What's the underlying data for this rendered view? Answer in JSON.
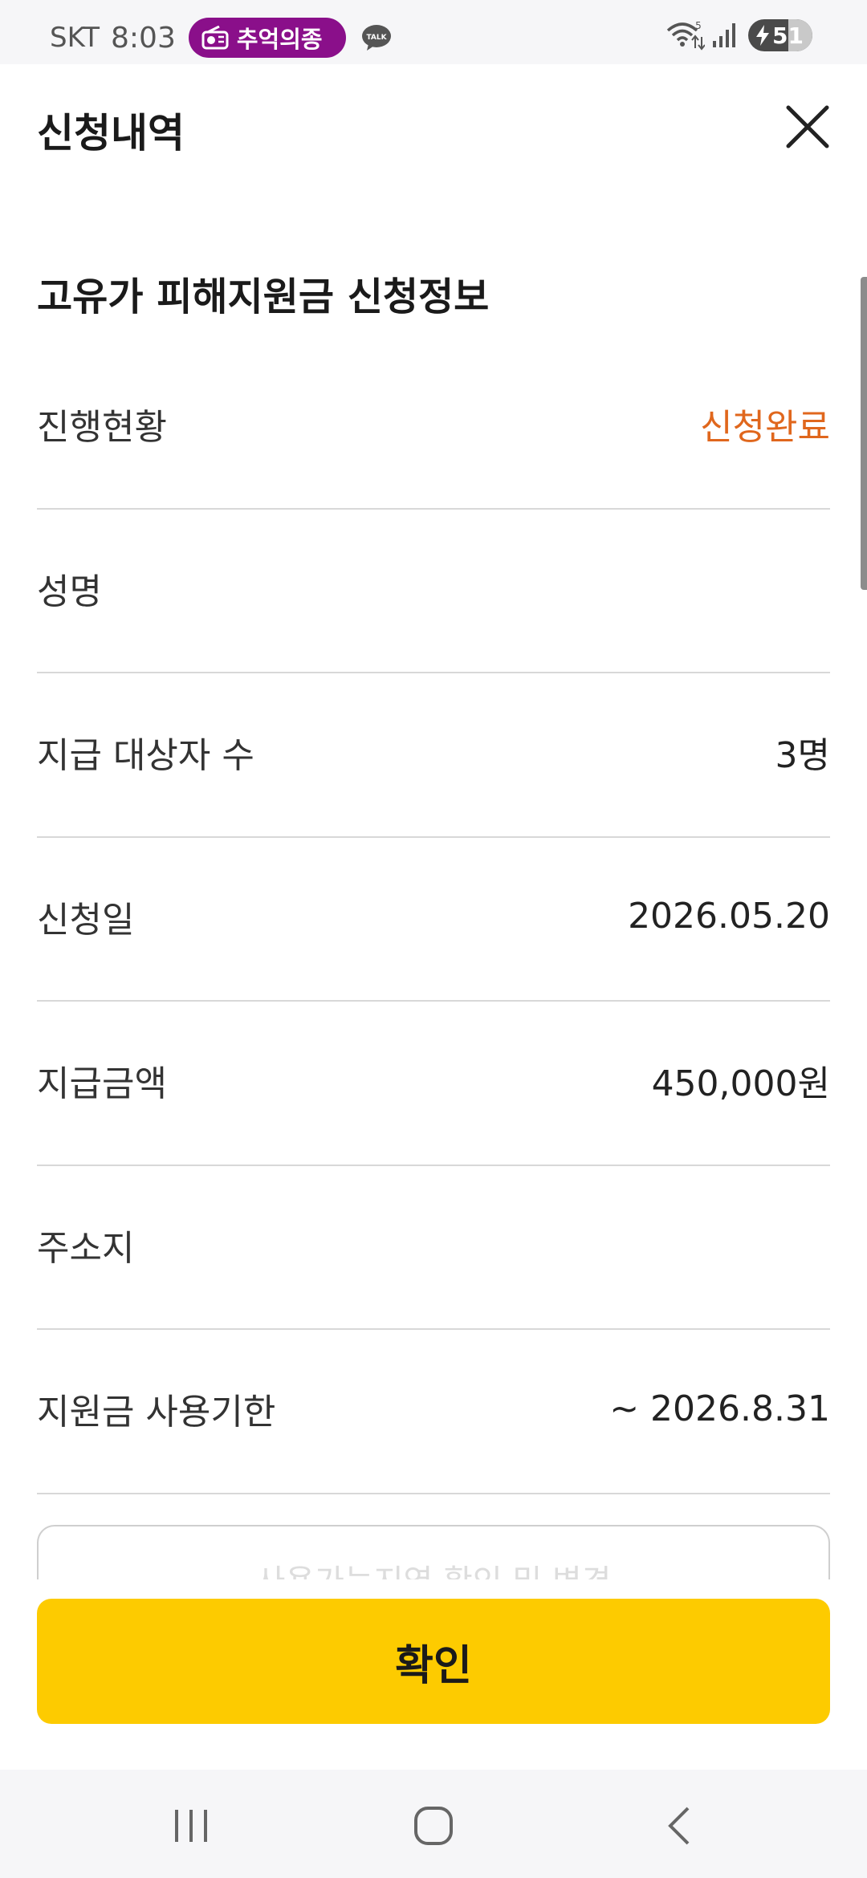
{
  "status_bar": {
    "carrier": "SKT",
    "time": "8:03",
    "radio_app": "추억의종",
    "notification_icon": "kakaotalk-icon",
    "talk_label": "TALK",
    "battery_level": "51",
    "network_label": "5"
  },
  "header": {
    "title": "신청내역",
    "close_icon": "close-icon"
  },
  "section_title": "고유가 피해지원금 신청정보",
  "info_rows": [
    {
      "label": "진행현황",
      "value": "신청완료"
    },
    {
      "label": "성명",
      "value": ""
    },
    {
      "label": "지급 대상자 수",
      "value": "3명"
    },
    {
      "label": "신청일",
      "value": "2026.05.20"
    },
    {
      "label": "지급금액",
      "value": "450,000원"
    },
    {
      "label": "주소지",
      "value": ""
    },
    {
      "label": "지원금 사용기한",
      "value": "~ 2026.8.31"
    }
  ],
  "region_button_label": "사용가능지역 확인 및 변경",
  "confirm_label": "확인",
  "colors": {
    "accent": "#fdcb00",
    "status": "#e0671d",
    "radio_pill": "#8a0f8a"
  },
  "nav_bar": {
    "recent_icon": "recent-apps-icon",
    "home_icon": "home-icon",
    "back_icon": "back-icon"
  }
}
